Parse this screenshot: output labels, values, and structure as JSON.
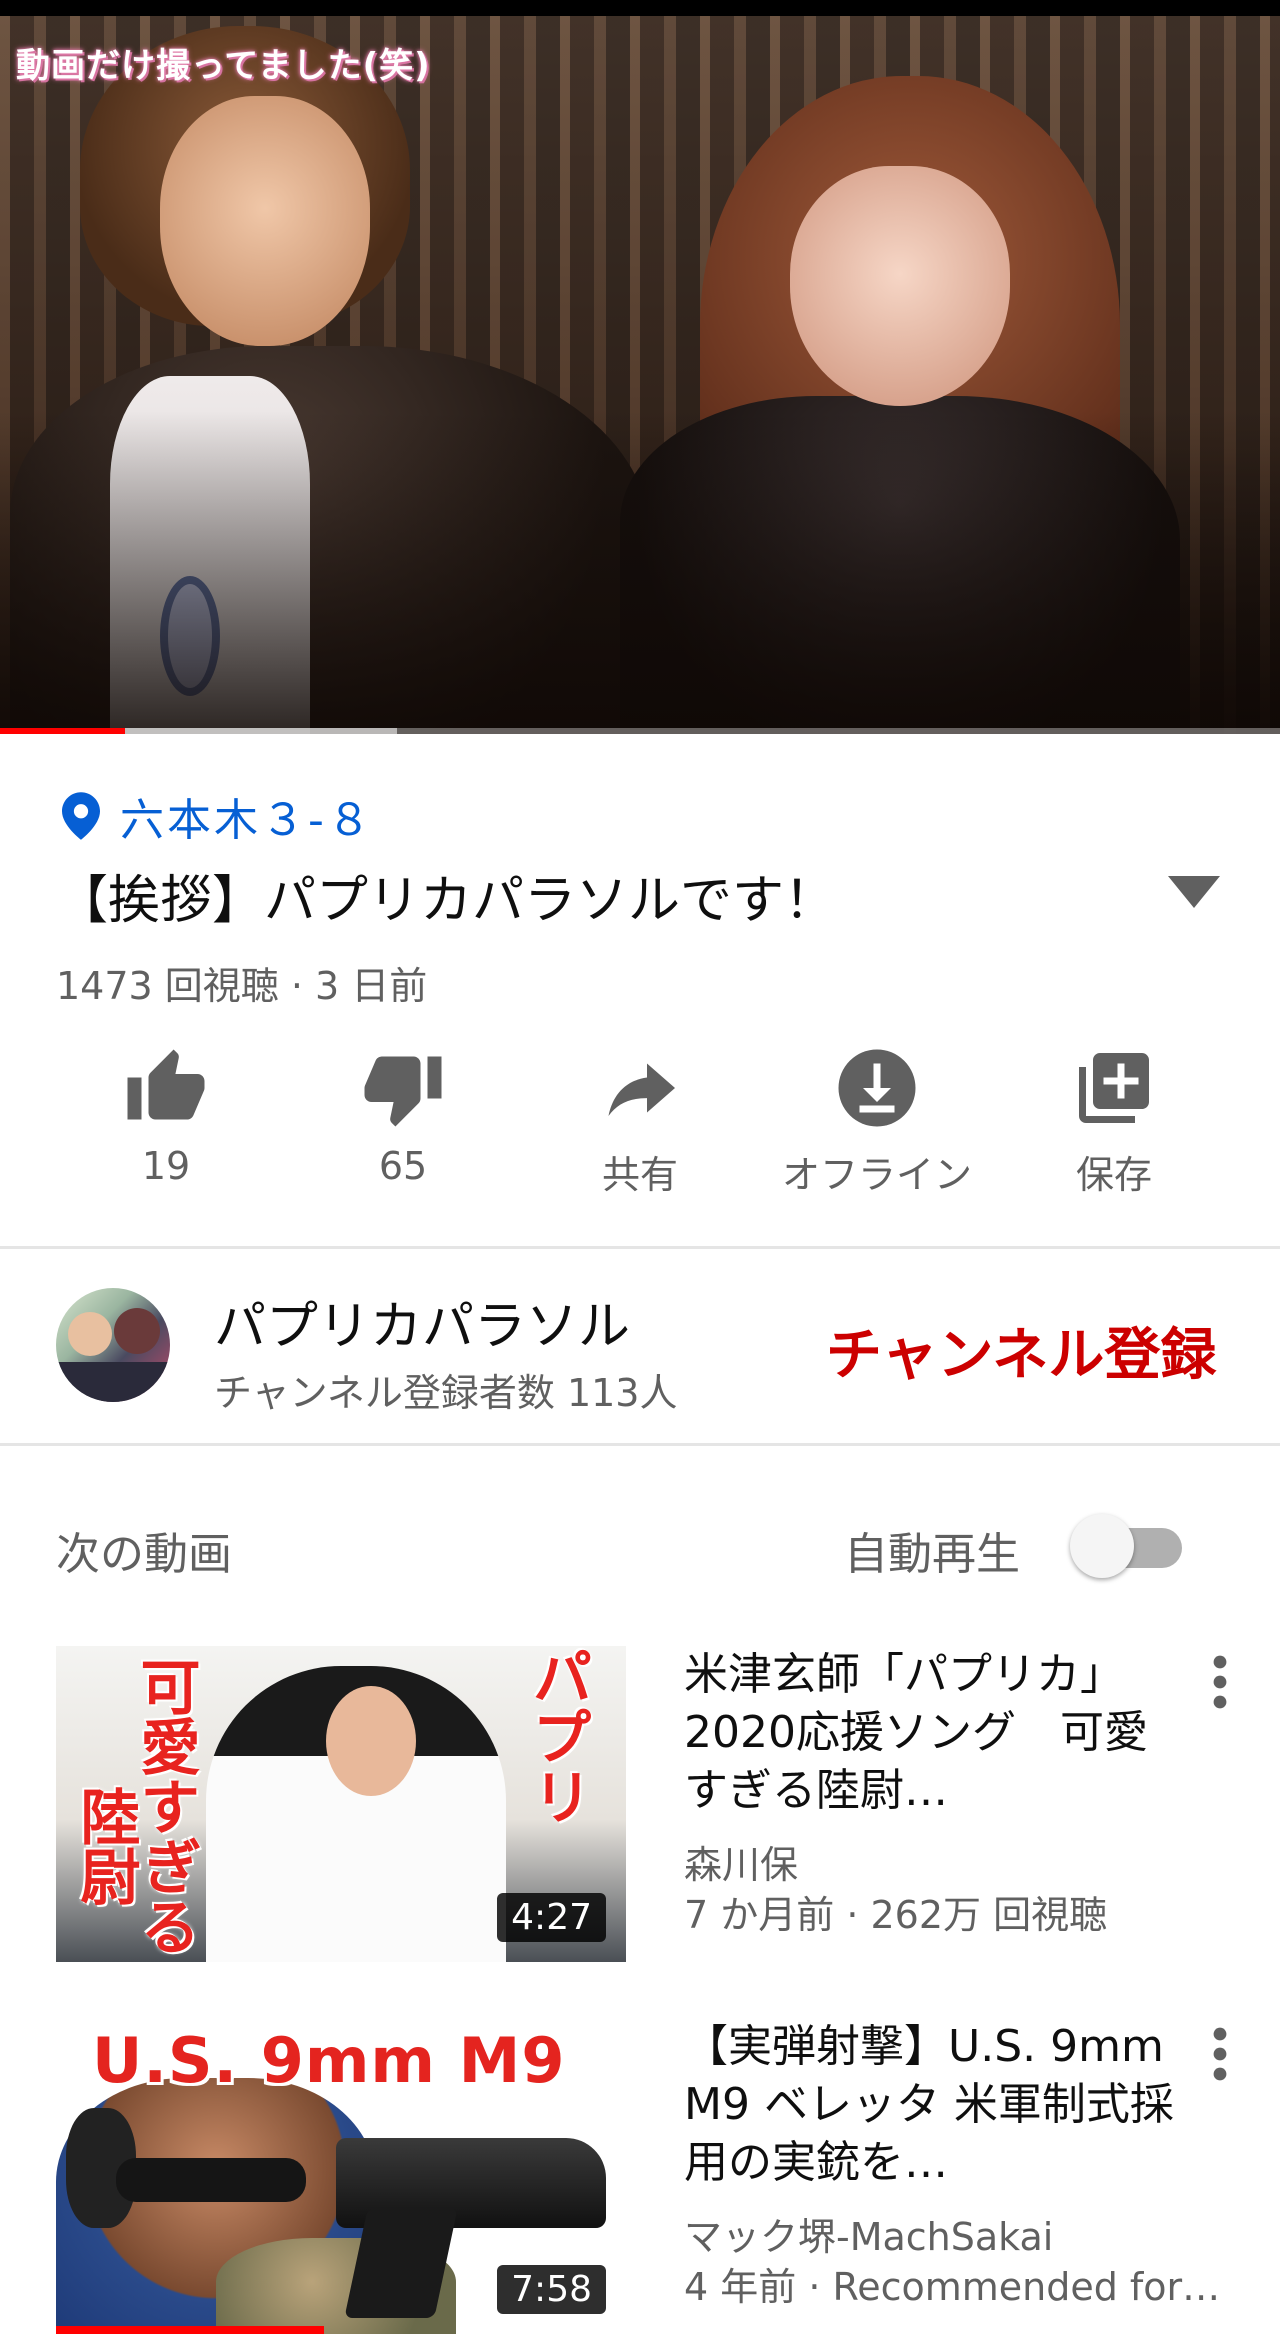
{
  "player": {
    "overlay_caption": "動画だけ撮ってました(笑)",
    "progress_played": 0.098,
    "progress_buffered": 0.31
  },
  "video": {
    "location": "六本木３-８",
    "title": "【挨拶】パプリカパラソルです！",
    "meta": "1473 回視聴 · 3 日前"
  },
  "actions": [
    {
      "icon": "thumbs-up-icon",
      "label": "19"
    },
    {
      "icon": "thumbs-down-icon",
      "label": "65"
    },
    {
      "icon": "share-icon",
      "label": "共有"
    },
    {
      "icon": "download-icon",
      "label": "オフライン"
    },
    {
      "icon": "add-to-playlist-icon",
      "label": "保存"
    }
  ],
  "channel": {
    "name": "パプリカパラソル",
    "subscribers": "チャンネル登録者数 113人",
    "subscribe_label": "チャンネル登録"
  },
  "up_next": {
    "heading": "次の動画",
    "autoplay_label": "自動再生",
    "autoplay_on": false,
    "videos": [
      {
        "title": "米津玄師「パプリカ」2020応援ソング　可愛すぎる陸尉…",
        "channel": "森川保",
        "meta": "7 か月前 · 262万 回視聴",
        "duration": "4:27",
        "thumb_text_left": "可愛すぎる",
        "thumb_text_left2": "陸尉",
        "thumb_text_right": "パプリ"
      },
      {
        "title": "【実弾射撃】U.S. 9mm M9 ベレッタ 米軍制式採用の実銃を…",
        "channel": "マック堺-MachSakai",
        "meta": "4 年前 · Recommended for…",
        "duration": "7:58",
        "thumb_text": "U.S. 9mm M9",
        "watched_fraction": 0.47
      }
    ]
  },
  "colors": {
    "accent_red": "#cc0000",
    "progress_red": "#ff0000",
    "link_blue": "#065fd4",
    "secondary_text": "#606060"
  }
}
